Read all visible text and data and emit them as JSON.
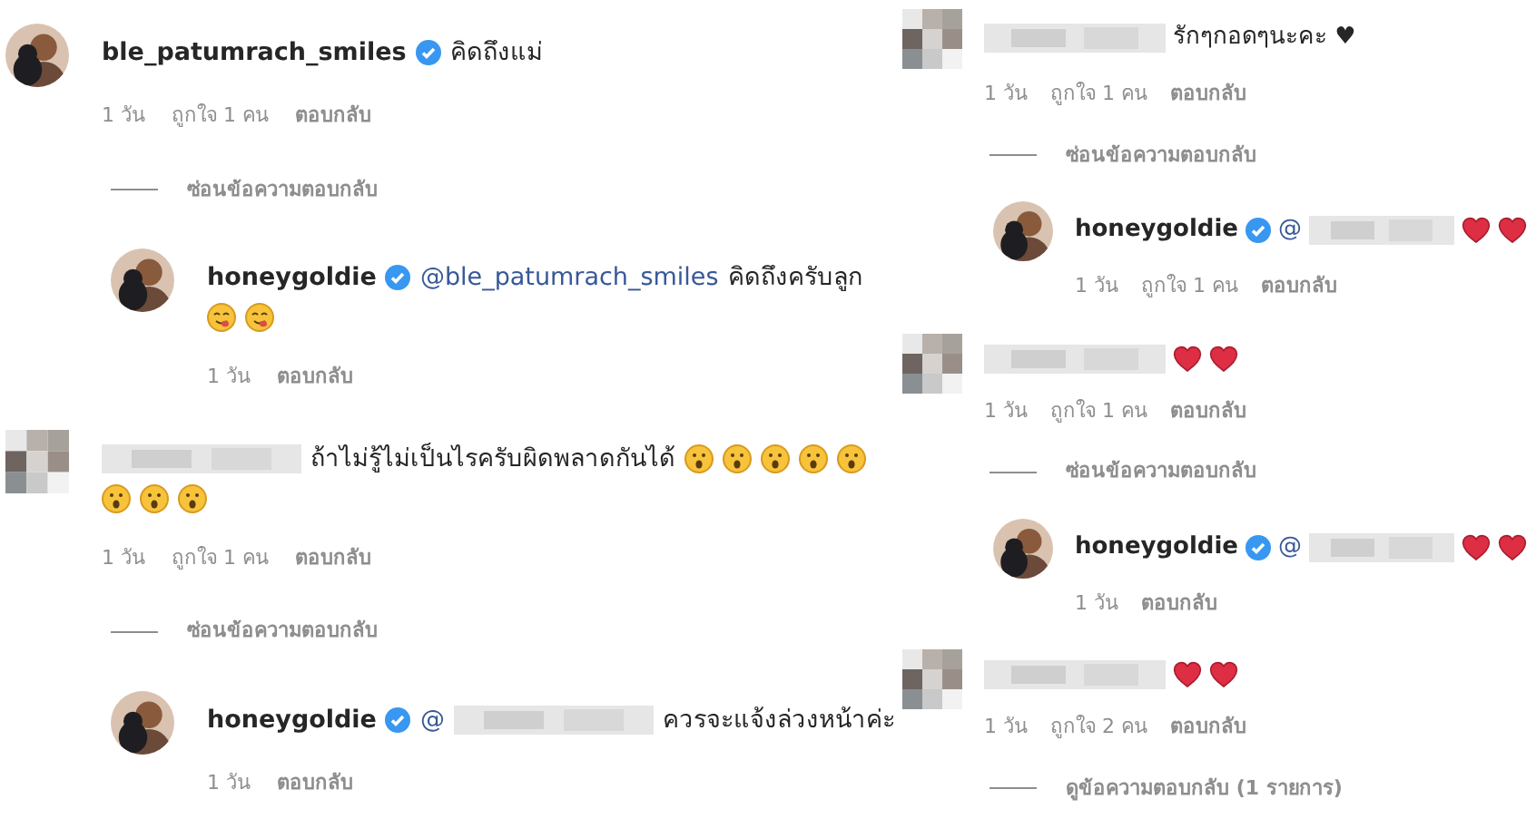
{
  "panels": [
    {
      "comments": [
        {
          "avatar": {
            "kind": "photo"
          },
          "username": "ble_patumrach_smiles",
          "verified": true,
          "text": "คิดถึงแม่",
          "meta": {
            "time": "1 วัน",
            "likes": "ถูกใจ 1 คน",
            "reply": "ตอบกลับ"
          },
          "toggle": "ซ่อนข้อความตอบกลับ",
          "replies": [
            {
              "avatar": {
                "kind": "photo"
              },
              "username": "honeygoldie",
              "verified": true,
              "mention": "@ble_patumrach_smiles",
              "text": "คิดถึงครับลูก",
              "emojis": [
                {
                  "kind": "savoring"
                },
                {
                  "kind": "savoring"
                }
              ],
              "meta": {
                "time": "1 วัน",
                "reply": "ตอบกลับ"
              }
            }
          ]
        },
        {
          "avatar": {
            "kind": "pixelated"
          },
          "username_blurred": true,
          "text": "ถ้าไม่รู้ไม่เป็นไรครับผิดพลาดกันได้",
          "emojis": [
            {
              "kind": "hushed"
            },
            {
              "kind": "hushed"
            },
            {
              "kind": "hushed"
            },
            {
              "kind": "hushed"
            },
            {
              "kind": "hushed"
            },
            {
              "kind": "hushed"
            },
            {
              "kind": "hushed"
            },
            {
              "kind": "hushed"
            }
          ],
          "meta": {
            "time": "1 วัน",
            "likes": "ถูกใจ 1 คน",
            "reply": "ตอบกลับ"
          },
          "toggle": "ซ่อนข้อความตอบกลับ",
          "replies": [
            {
              "avatar": {
                "kind": "photo"
              },
              "username": "honeygoldie",
              "verified": true,
              "mention": "@",
              "mention_blurred": true,
              "text": "ควรจะแจ้งล่วงหน้าค่ะ",
              "meta": {
                "time": "1 วัน",
                "reply": "ตอบกลับ"
              }
            }
          ]
        }
      ]
    },
    {
      "comments": [
        {
          "avatar": {
            "kind": "pixelated"
          },
          "username_blurred": true,
          "text": "รักๆกอดๆนะคะ ♥",
          "meta": {
            "time": "1 วัน",
            "likes": "ถูกใจ 1 คน",
            "reply": "ตอบกลับ"
          },
          "toggle": "ซ่อนข้อความตอบกลับ",
          "replies": [
            {
              "avatar": {
                "kind": "photo"
              },
              "username": "honeygoldie",
              "verified": true,
              "mention": "@",
              "mention_blurred": true,
              "emojis": [
                {
                  "kind": "red-heart"
                },
                {
                  "kind": "red-heart"
                }
              ],
              "meta": {
                "time": "1 วัน",
                "likes": "ถูกใจ 1 คน",
                "reply": "ตอบกลับ"
              }
            }
          ]
        },
        {
          "avatar": {
            "kind": "pixelated"
          },
          "username_blurred": true,
          "emojis": [
            {
              "kind": "red-heart"
            },
            {
              "kind": "red-heart"
            }
          ],
          "meta": {
            "time": "1 วัน",
            "likes": "ถูกใจ 1 คน",
            "reply": "ตอบกลับ"
          },
          "toggle": "ซ่อนข้อความตอบกลับ",
          "replies": [
            {
              "avatar": {
                "kind": "photo"
              },
              "username": "honeygoldie",
              "verified": true,
              "mention": "@",
              "mention_blurred": true,
              "emojis": [
                {
                  "kind": "red-heart"
                },
                {
                  "kind": "red-heart"
                }
              ],
              "meta": {
                "time": "1 วัน",
                "reply": "ตอบกลับ"
              }
            }
          ]
        },
        {
          "avatar": {
            "kind": "pixelated"
          },
          "username_blurred": true,
          "emojis": [
            {
              "kind": "red-heart"
            },
            {
              "kind": "red-heart"
            }
          ],
          "meta": {
            "time": "1 วัน",
            "likes": "ถูกใจ 2 คน",
            "reply": "ตอบกลับ"
          },
          "toggle": "ดูข้อความตอบกลับ (1 รายการ)"
        }
      ]
    }
  ]
}
